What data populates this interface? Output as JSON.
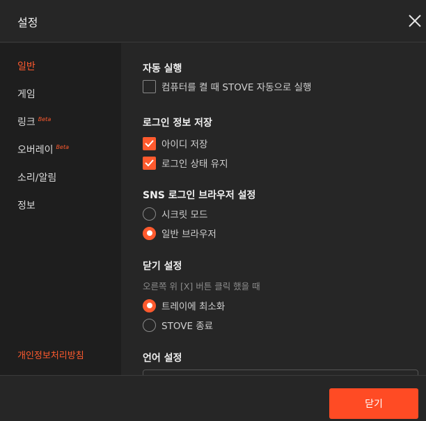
{
  "header": {
    "title": "설정",
    "close_icon": "close-icon"
  },
  "sidebar": {
    "items": [
      {
        "label": "일반",
        "active": true
      },
      {
        "label": "게임"
      },
      {
        "label": "링크",
        "beta": "Beta"
      },
      {
        "label": "오버레이",
        "beta": "Beta"
      },
      {
        "label": "소리/알림"
      },
      {
        "label": "정보"
      }
    ],
    "privacy_link": "개인정보처리방침"
  },
  "sections": {
    "autorun": {
      "title": "자동 실행",
      "option": "컴퓨터를 켤 때 STOVE 자동으로 실행",
      "checked": false
    },
    "login_save": {
      "title": "로그인 정보 저장",
      "options": [
        {
          "label": "아이디 저장",
          "checked": true
        },
        {
          "label": "로그인 상태 유지",
          "checked": true
        }
      ]
    },
    "sns_browser": {
      "title": "SNS 로그인 브라우저 설정",
      "options": [
        {
          "label": "시크릿 모드",
          "selected": false
        },
        {
          "label": "일반 브라우저",
          "selected": true
        }
      ]
    },
    "close_setting": {
      "title": "닫기 설정",
      "description": "오른쪽 위 [X] 버튼 클릭 했을 때",
      "options": [
        {
          "label": "트레이에 최소화",
          "selected": true
        },
        {
          "label": "STOVE 종료",
          "selected": false
        }
      ]
    },
    "language": {
      "title": "언어 설정"
    }
  },
  "footer": {
    "close_button": "닫기"
  },
  "colors": {
    "accent": "#ff5a2e",
    "background": "#262626",
    "sidebar": "#1e1e1e"
  }
}
